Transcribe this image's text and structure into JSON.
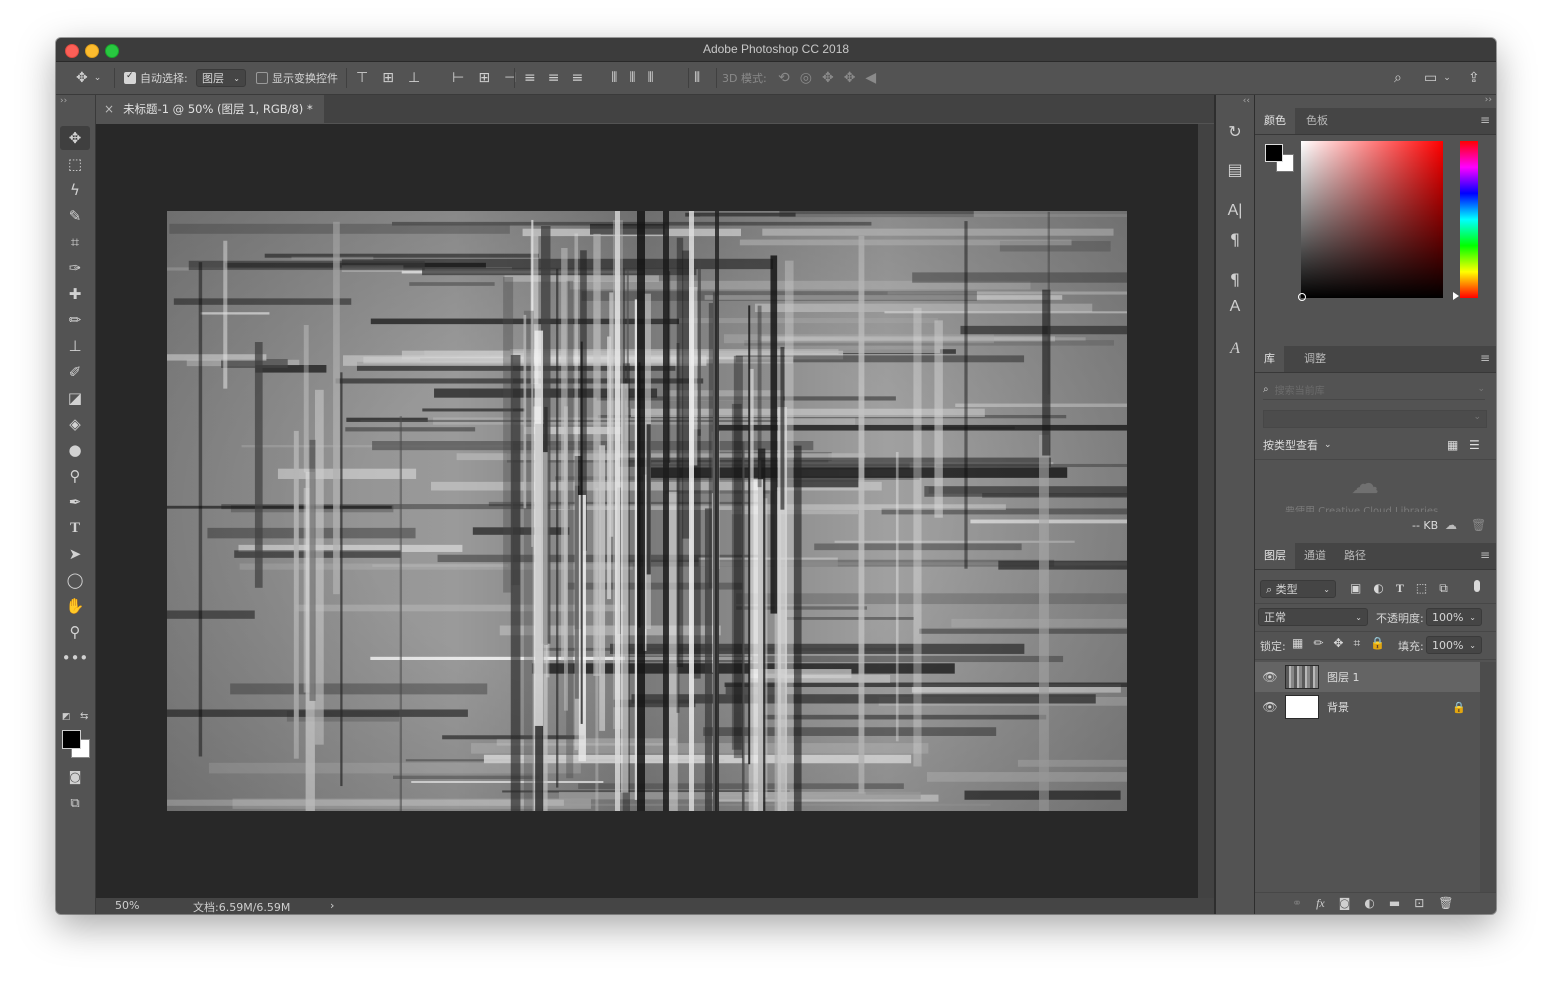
{
  "app": {
    "title": "Adobe Photoshop CC 2018"
  },
  "options_bar": {
    "auto_select_label": "自动选择:",
    "auto_select_checked": true,
    "auto_select_target": "图层",
    "show_transform_label": "显示变换控件",
    "show_transform_checked": false,
    "mode_3d_label": "3D 模式:"
  },
  "document": {
    "tab_title": "未标题-1 @ 50% (图层 1, RGB/8) *",
    "close_glyph": "×",
    "collapse_glyph": "››"
  },
  "status": {
    "zoom": "50%",
    "doc_size": "文档:6.59M/6.59M",
    "arrow": "›"
  },
  "color_panel": {
    "tabs": [
      "颜色",
      "色板"
    ],
    "foreground": "#000000",
    "background": "#ffffff"
  },
  "library_panel": {
    "tabs": [
      "库",
      "调整"
    ],
    "search_placeholder": "搜索当前库",
    "view_by": "按类型查看",
    "size_label": "-- KB",
    "hint": "要使用 Creative Cloud Libraries"
  },
  "layers_panel": {
    "tabs": [
      "图层",
      "通道",
      "路径"
    ],
    "filter_label": "类型",
    "blend_mode": "正常",
    "opacity_label": "不透明度:",
    "opacity_value": "100%",
    "lock_label": "锁定:",
    "fill_label": "填充:",
    "fill_value": "100%",
    "layers": [
      {
        "name": "图层 1",
        "selected": true,
        "locked": false
      },
      {
        "name": "背景",
        "selected": false,
        "locked": true
      }
    ]
  },
  "tools": [
    "move-tool",
    "marquee-tool",
    "lasso-tool",
    "quick-select-tool",
    "crop-tool",
    "eyedropper-tool",
    "healing-tool",
    "brush-tool",
    "stamp-tool",
    "history-brush-tool",
    "eraser-tool",
    "paint-bucket-tool",
    "blur-tool",
    "dodge-tool",
    "pen-tool",
    "type-tool",
    "path-select-tool",
    "ellipse-tool",
    "hand-tool",
    "zoom-tool",
    "more-tools"
  ]
}
